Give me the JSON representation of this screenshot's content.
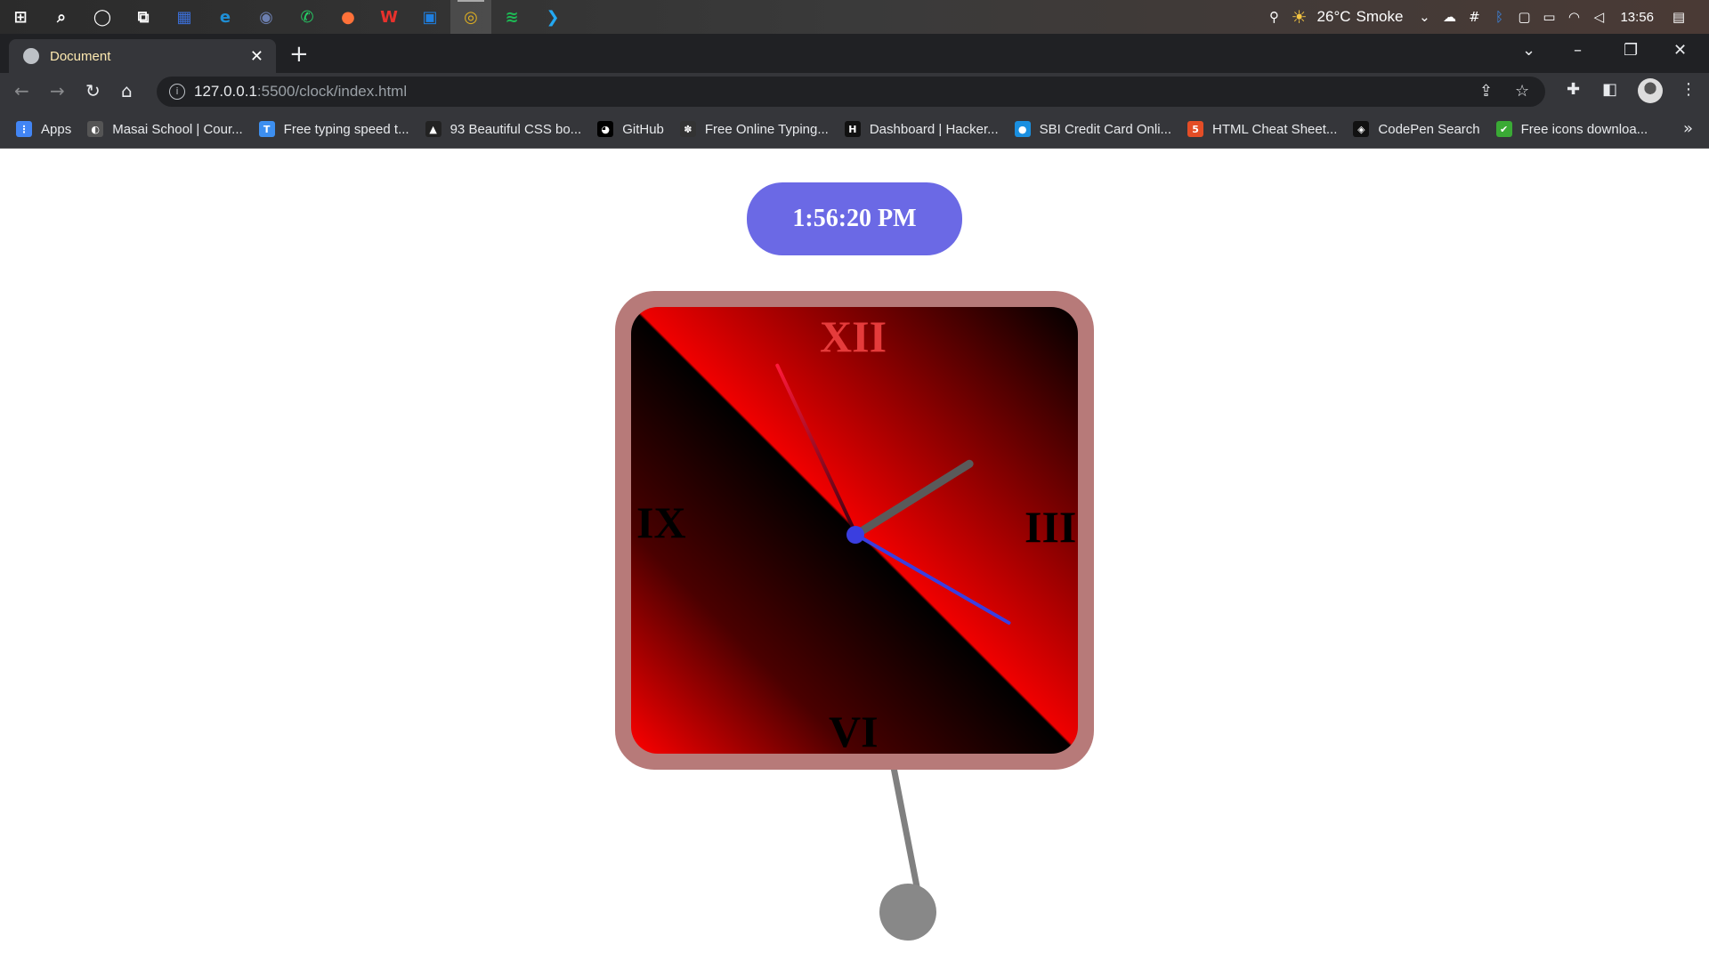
{
  "taskbar": {
    "apps": [
      {
        "name": "windows-start-icon",
        "glyph": "⊞",
        "color": "#ffffff"
      },
      {
        "name": "search-icon",
        "glyph": "⌕",
        "color": "#ffffff"
      },
      {
        "name": "cortana-icon",
        "glyph": "◯",
        "color": "#ffffff"
      },
      {
        "name": "task-view-icon",
        "glyph": "⧉",
        "color": "#ffffff"
      },
      {
        "name": "calculator-icon",
        "glyph": "▦",
        "color": "#3b6fd9"
      },
      {
        "name": "edge-icon",
        "glyph": "e",
        "color": "#1f8fd6"
      },
      {
        "name": "camera-icon",
        "glyph": "◉",
        "color": "#6c7fb0"
      },
      {
        "name": "whatsapp-icon",
        "glyph": "✆",
        "color": "#25d366"
      },
      {
        "name": "firefox-icon",
        "glyph": "●",
        "color": "#ff7139"
      },
      {
        "name": "wps-office-icon",
        "glyph": "W",
        "color": "#e8312c"
      },
      {
        "name": "store-icon",
        "glyph": "▣",
        "color": "#1f7fe0"
      },
      {
        "name": "chrome-icon",
        "glyph": "◎",
        "color": "#e0b020"
      },
      {
        "name": "spotify-icon",
        "glyph": "≋",
        "color": "#1db954"
      },
      {
        "name": "vscode-icon",
        "glyph": "❯",
        "color": "#23a8f2"
      }
    ],
    "tray": {
      "weather_temp": "26°C",
      "weather_desc": "Smoke",
      "time": "13:56"
    }
  },
  "browser": {
    "tab_title": "Document",
    "url_host": "127.0.0.1",
    "url_rest": ":5500/clock/index.html",
    "bookmarks": [
      {
        "label": "Apps",
        "color": "#4285f4",
        "glyph": "⋮"
      },
      {
        "label": "Masai School | Cour...",
        "color": "#555555",
        "glyph": "◐"
      },
      {
        "label": "Free typing speed t...",
        "color": "#3d8ff0",
        "glyph": "T"
      },
      {
        "label": "93 Beautiful CSS bo...",
        "color": "#222222",
        "glyph": "▲"
      },
      {
        "label": "GitHub",
        "color": "#000000",
        "glyph": "◕"
      },
      {
        "label": "Free Online Typing...",
        "color": "#333333",
        "glyph": "✽"
      },
      {
        "label": "Dashboard | Hacker...",
        "color": "#111111",
        "glyph": "H"
      },
      {
        "label": "SBI Credit Card Onli...",
        "color": "#1a8fe0",
        "glyph": "●"
      },
      {
        "label": "HTML Cheat Sheet...",
        "color": "#e44d26",
        "glyph": "5"
      },
      {
        "label": "CodePen Search",
        "color": "#111111",
        "glyph": "◈"
      },
      {
        "label": "Free icons downloa...",
        "color": "#3aaa35",
        "glyph": "✔"
      }
    ]
  },
  "page": {
    "digital_time": "1:56:20 PM",
    "numerals": {
      "twelve": "XII",
      "three": "III",
      "six": "VI",
      "nine": "IX"
    }
  }
}
